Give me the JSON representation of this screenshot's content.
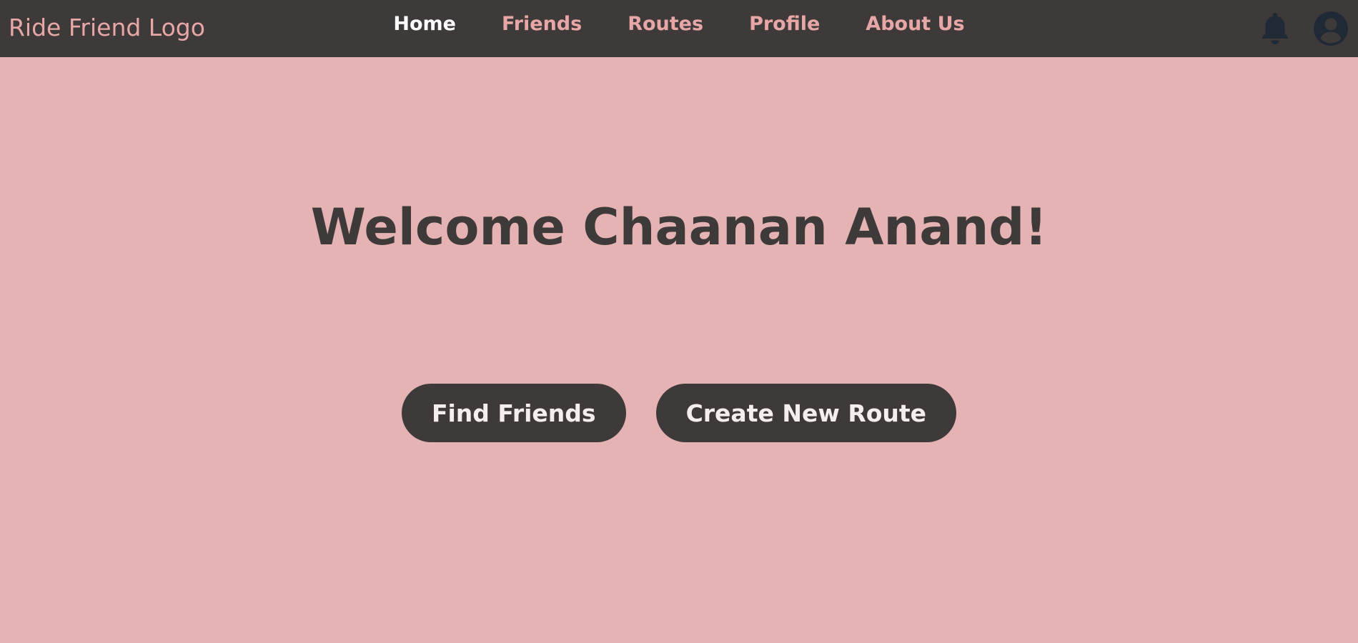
{
  "navbar": {
    "logo_text": "Ride Friend Logo",
    "links": [
      {
        "label": "Home",
        "active": true
      },
      {
        "label": "Friends",
        "active": false
      },
      {
        "label": "Routes",
        "active": false
      },
      {
        "label": "Profile",
        "active": false
      },
      {
        "label": "About Us",
        "active": false
      }
    ],
    "icons": {
      "notifications": "bell-icon",
      "account": "user-avatar-icon"
    }
  },
  "main": {
    "welcome_text": "Welcome Chaanan Anand!",
    "buttons": {
      "find_friends": "Find Friends",
      "create_route": "Create New Route"
    }
  },
  "colors": {
    "background": "#e5b3b3",
    "navbar": "#3f3a3a",
    "accent": "#e8a7a7",
    "button_text": "#f5eeee",
    "icon": "#1f2a36"
  }
}
